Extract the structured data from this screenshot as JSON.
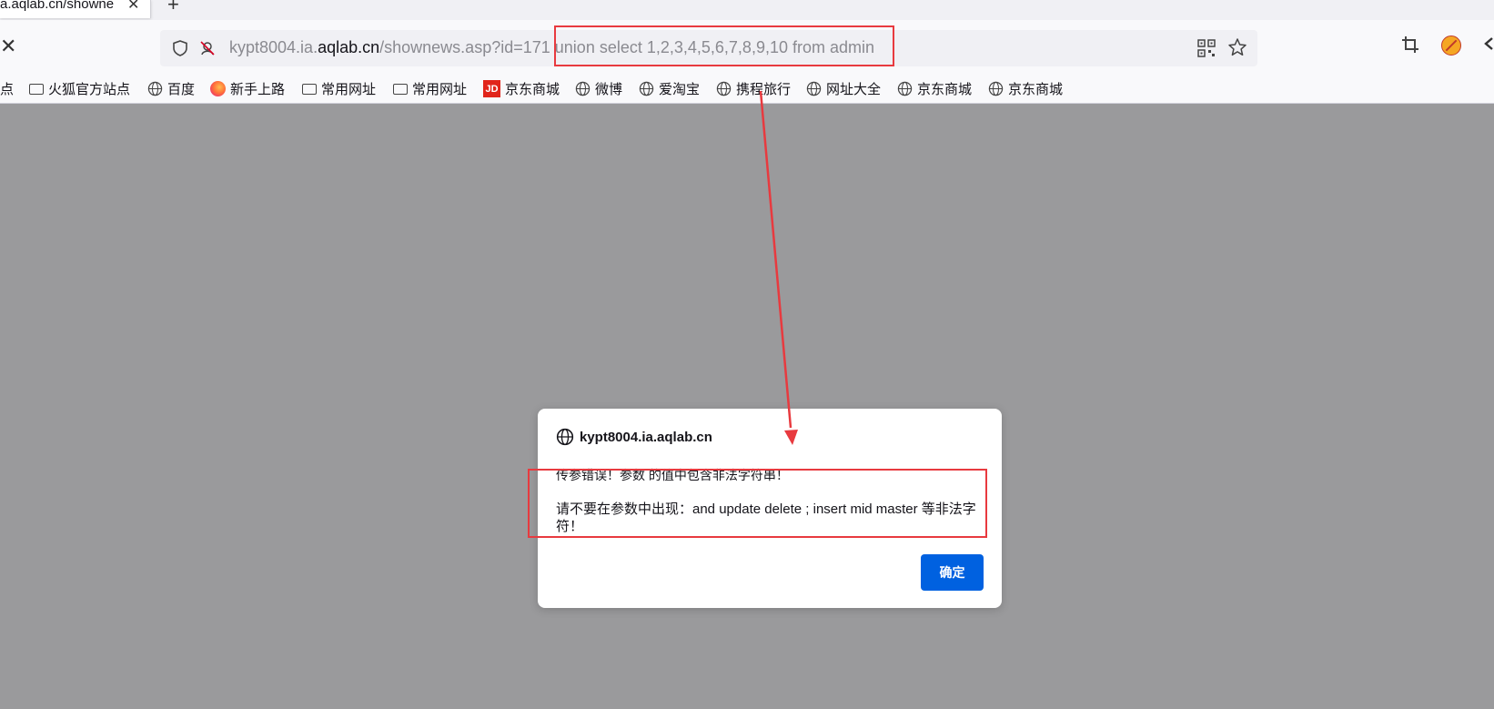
{
  "tab": {
    "title": "a.aqlab.cn/showne",
    "close_glyph": "✕",
    "new_tab_glyph": "+"
  },
  "nav": {
    "stop_glyph": "✕"
  },
  "url": {
    "prefix": "kypt8004.ia.",
    "domain": "aqlab.cn",
    "path": "/shownews.asp?id=171",
    "injection": " union select 1,2,3,4,5,6,7,8,9,10 from admin"
  },
  "bookmarks": [
    {
      "label": "点",
      "icon": "none"
    },
    {
      "label": "火狐官方站点",
      "icon": "folder-icon"
    },
    {
      "label": "百度",
      "icon": "globe-icon"
    },
    {
      "label": "新手上路",
      "icon": "firefox-icon"
    },
    {
      "label": "常用网址",
      "icon": "folder-icon"
    },
    {
      "label": "常用网址",
      "icon": "folder-icon"
    },
    {
      "label": "京东商城",
      "icon": "jd-icon"
    },
    {
      "label": "微博",
      "icon": "globe-icon"
    },
    {
      "label": "爱淘宝",
      "icon": "globe-icon"
    },
    {
      "label": "携程旅行",
      "icon": "globe-icon"
    },
    {
      "label": "网址大全",
      "icon": "globe-icon"
    },
    {
      "label": "京东商城",
      "icon": "globe-icon"
    },
    {
      "label": "京东商城",
      "icon": "globe-icon"
    }
  ],
  "jd_logo_text": "JD",
  "dialog": {
    "host": "kypt8004.ia.aqlab.cn",
    "line1": "传参错误！参数 的值中包含非法字符串！",
    "line2": "请不要在参数中出现：and update delete ; insert mid master 等非法字符！",
    "ok_label": "确定"
  },
  "colors": {
    "annotation": "#e83a3f",
    "button": "#0061e0",
    "overlay": "#9a9a9c"
  }
}
